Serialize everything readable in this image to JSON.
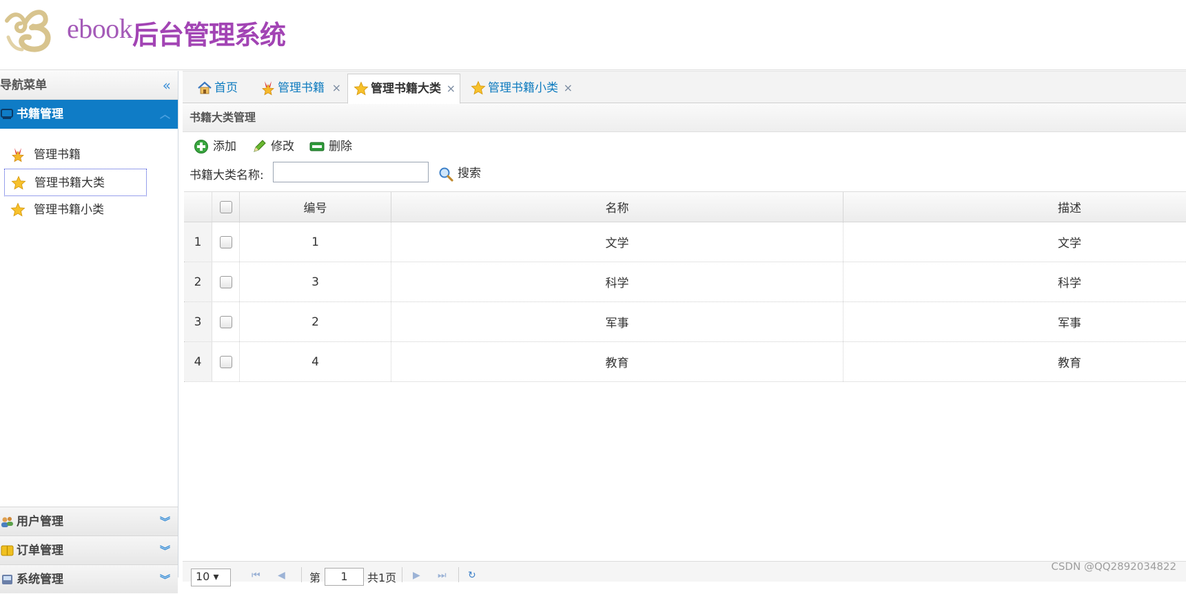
{
  "header": {
    "logo_ebook": "ebook",
    "logo_title": "后台管理系统"
  },
  "sidebar": {
    "nav_title": "导航菜单",
    "active_group": {
      "label": "书籍管理",
      "items": [
        {
          "label": "管理书籍",
          "icon": "medal-icon"
        },
        {
          "label": "管理书籍大类",
          "icon": "star-icon",
          "selected": true
        },
        {
          "label": "管理书籍小类",
          "icon": "star-icon"
        }
      ]
    },
    "groups": [
      {
        "label": "用户管理",
        "icon": "users-icon"
      },
      {
        "label": "订单管理",
        "icon": "orders-icon"
      },
      {
        "label": "系统管理",
        "icon": "system-icon"
      }
    ]
  },
  "tabs": [
    {
      "label": "首页",
      "icon": "home-icon",
      "closable": false
    },
    {
      "label": "管理书籍",
      "icon": "medal-icon",
      "closable": true
    },
    {
      "label": "管理书籍大类",
      "icon": "star-icon",
      "closable": true,
      "active": true
    },
    {
      "label": "管理书籍小类",
      "icon": "star-icon",
      "closable": true
    }
  ],
  "panel": {
    "title": "书籍大类管理",
    "toolbar": {
      "add_label": "添加",
      "edit_label": "修改",
      "delete_label": "删除"
    },
    "search": {
      "label": "书籍大类名称:",
      "value": "",
      "button_label": "搜索"
    }
  },
  "grid": {
    "columns": [
      "编号",
      "名称",
      "描述"
    ],
    "rows": [
      {
        "n": "1",
        "id": "1",
        "name": "文学",
        "desc": "文学"
      },
      {
        "n": "2",
        "id": "3",
        "name": "科学",
        "desc": "科学"
      },
      {
        "n": "3",
        "id": "2",
        "name": "军事",
        "desc": "军事"
      },
      {
        "n": "4",
        "id": "4",
        "name": "教育",
        "desc": "教育"
      }
    ]
  },
  "pager": {
    "page_size": "10",
    "page_prefix": "第",
    "page_value": "1",
    "page_total": "共1页"
  },
  "watermark": "CSDN @QQ2892034822",
  "colors": {
    "accent": "#0f7cc6",
    "logo_purple": "#a244b4",
    "tab_text": "#0e7bbf"
  }
}
